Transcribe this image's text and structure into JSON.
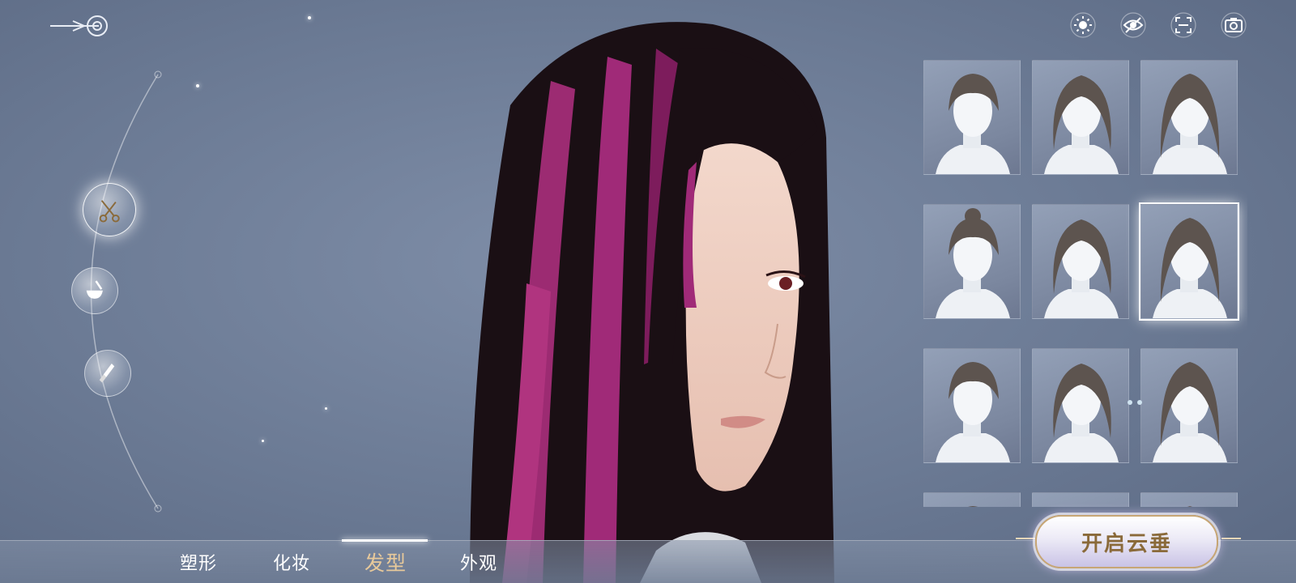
{
  "toolbar": {
    "icons": [
      "sun-icon",
      "eye-off-icon",
      "fullscreen-icon",
      "camera-icon"
    ]
  },
  "side_menu": {
    "items": [
      {
        "icon": "scissors-icon",
        "active": true
      },
      {
        "icon": "dye-bowl-icon",
        "active": false
      },
      {
        "icon": "brush-icon",
        "active": false
      }
    ]
  },
  "hair_styles": {
    "selected_index": 5,
    "count_visible": 12
  },
  "tabs": [
    {
      "label": "塑形",
      "active": false
    },
    {
      "label": "化妆",
      "active": false
    },
    {
      "label": "发型",
      "active": true
    },
    {
      "label": "外观",
      "active": false
    }
  ],
  "primary_action": {
    "label": "开启云垂"
  },
  "colors": {
    "background": "#6b7a94",
    "accent_gold": "#c7a675",
    "active_tab": "#e8c99a",
    "hair_highlight": "#a02a78"
  }
}
